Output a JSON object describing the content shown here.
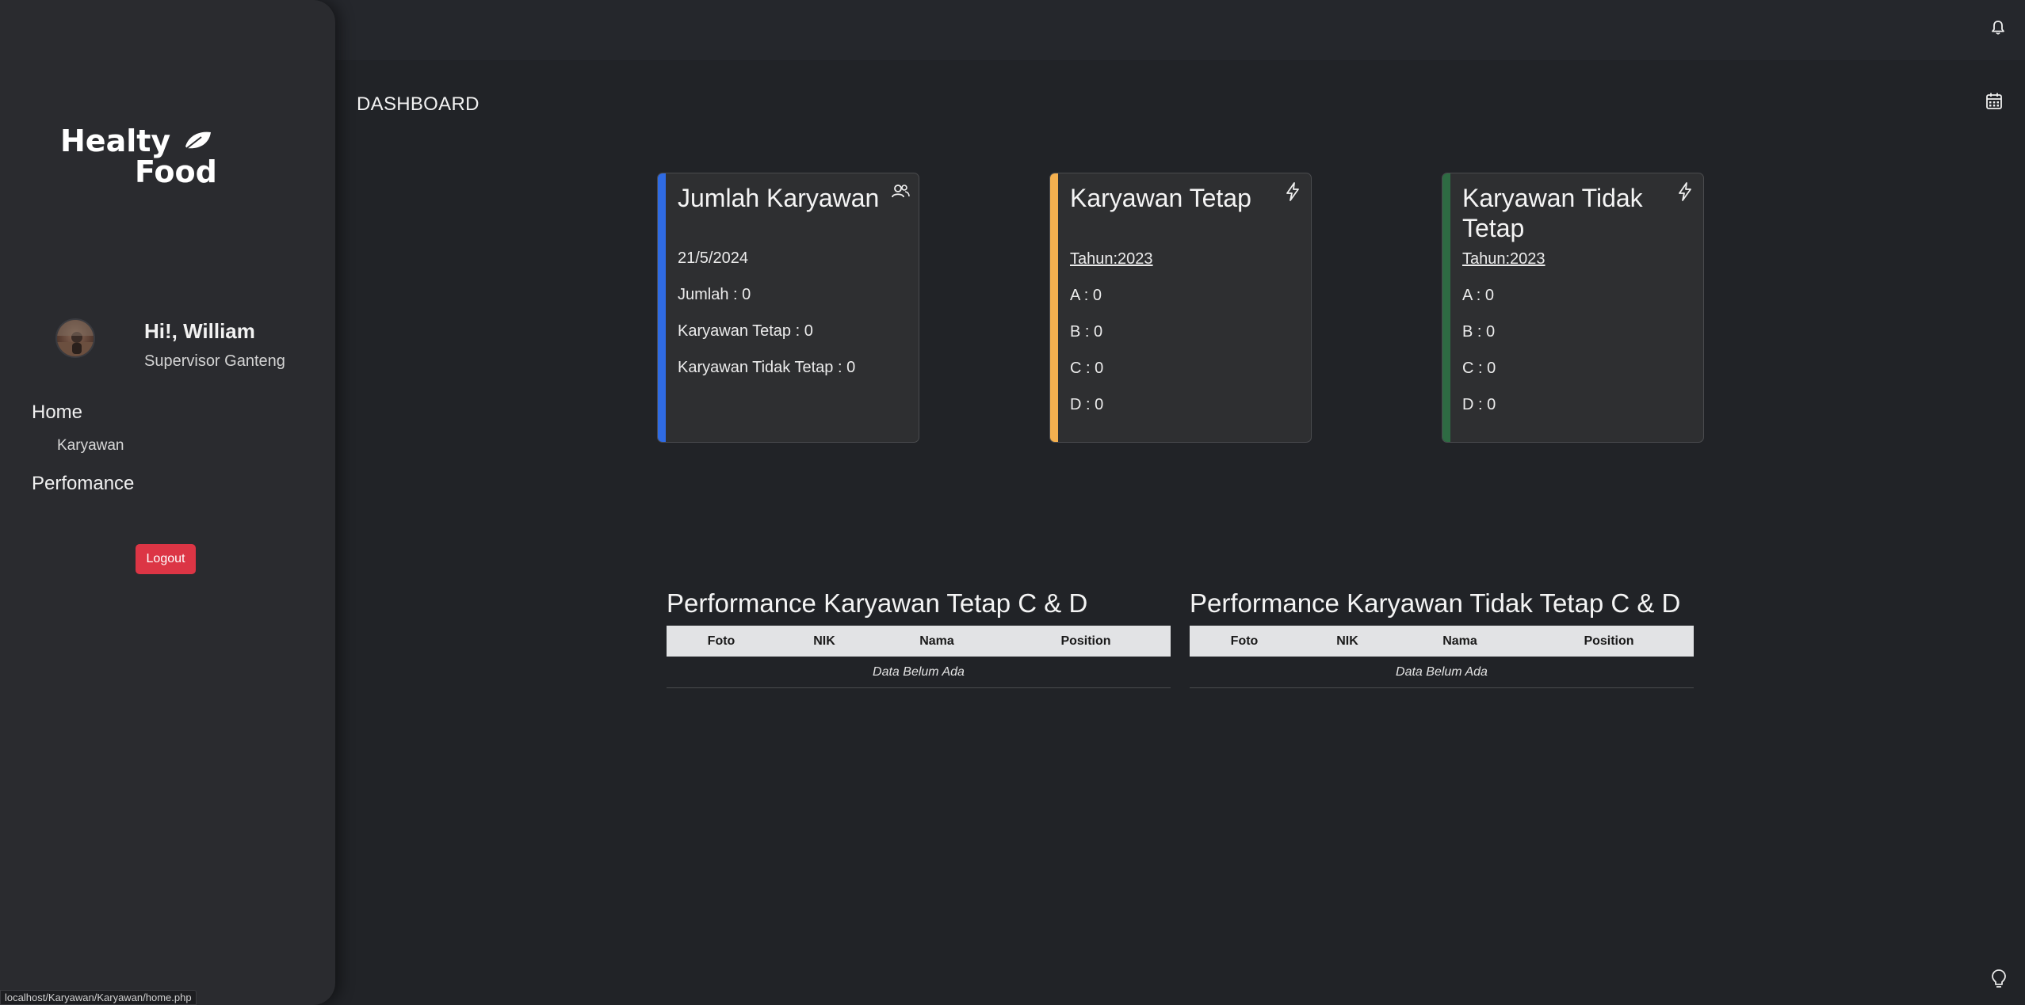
{
  "topbar": {
    "notification_icon": "bell-icon"
  },
  "sidebar": {
    "logo": {
      "line1": "Healty",
      "line2": "Food",
      "icon": "leaf-icon"
    },
    "user": {
      "greeting": "Hi!, William",
      "role": "Supervisor Ganteng"
    },
    "nav": {
      "home": "Home",
      "karyawan": "Karyawan",
      "performance": "Perfomance"
    },
    "logout_label": "Logout"
  },
  "page": {
    "title": "DASHBOARD",
    "calendar_icon": "calendar-icon"
  },
  "cards": [
    {
      "title": "Jumlah Karyawan",
      "accent": "#2f6be3",
      "icon": "users-icon",
      "date": "21/5/2024",
      "lines": [
        "Jumlah : 0",
        "Karyawan Tetap : 0",
        "Karyawan Tidak Tetap : 0"
      ]
    },
    {
      "title": "Karyawan Tetap",
      "accent": "#f4b04f",
      "icon": "bolt-icon",
      "year": "Tahun:2023",
      "lines": [
        "A : 0",
        "B : 0",
        "C : 0",
        "D : 0"
      ]
    },
    {
      "title": "Karyawan Tidak Tetap",
      "accent": "#2e6b43",
      "icon": "bolt-icon",
      "year": "Tahun:2023",
      "lines": [
        "A : 0",
        "B : 0",
        "C : 0",
        "D : 0"
      ]
    }
  ],
  "tables": [
    {
      "title": "Performance Karyawan Tetap C & D",
      "columns": [
        "Foto",
        "NIK",
        "Nama",
        "Position"
      ],
      "empty_text": "Data Belum Ada"
    },
    {
      "title": "Performance Karyawan Tidak Tetap C & D",
      "columns": [
        "Foto",
        "NIK",
        "Nama",
        "Position"
      ],
      "empty_text": "Data Belum Ada"
    }
  ],
  "status_bar": {
    "url": "localhost/Karyawan/Karyawan/home.php"
  },
  "theme_toggle_icon": "lightbulb-icon"
}
